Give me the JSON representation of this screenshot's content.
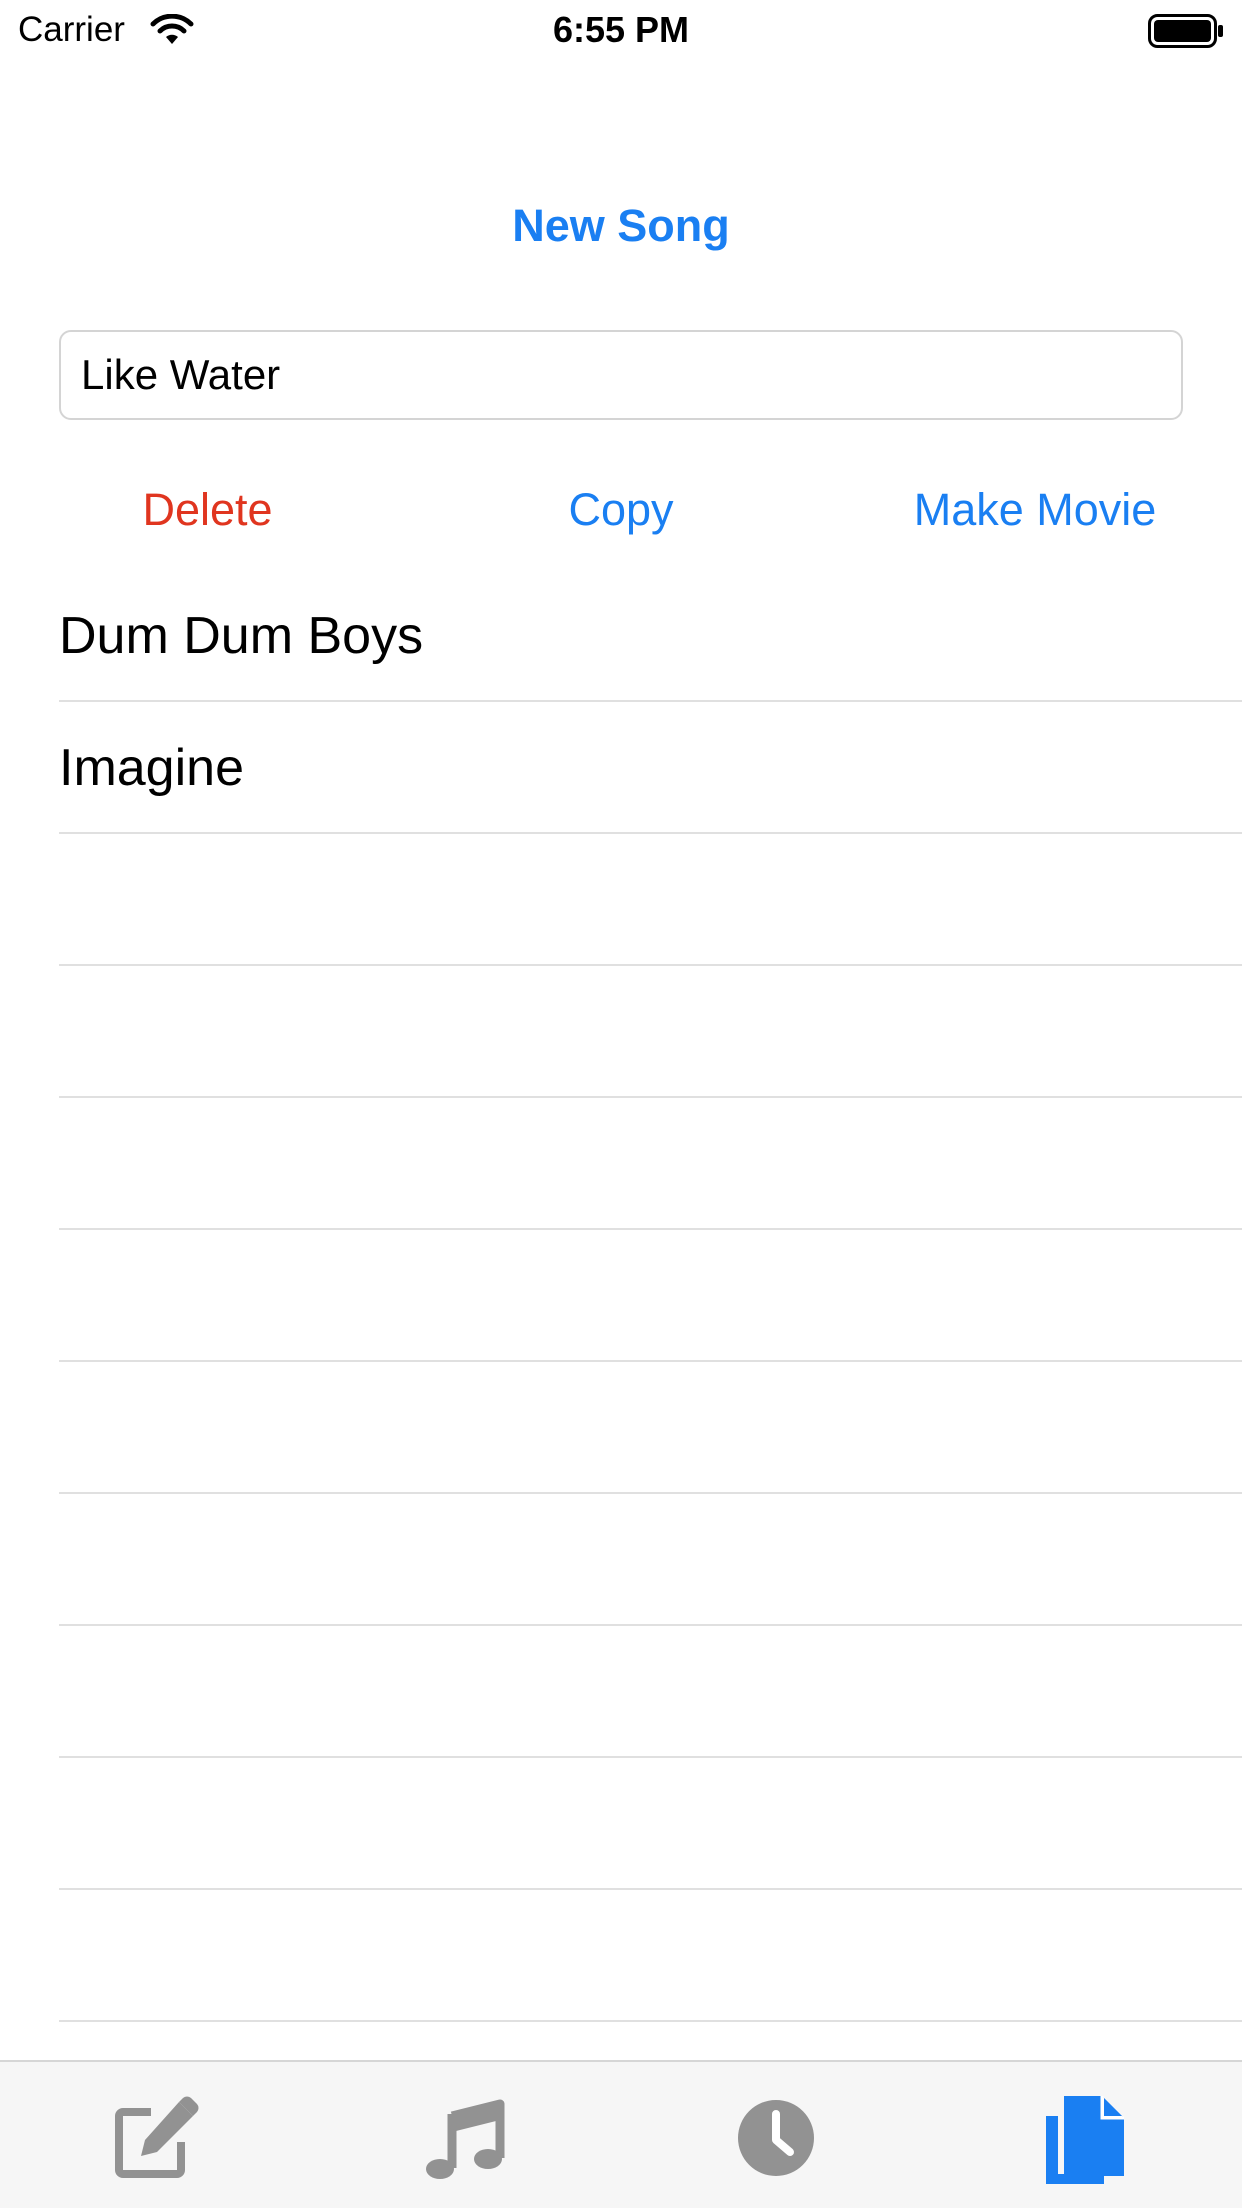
{
  "status_bar": {
    "carrier": "Carrier",
    "time": "6:55 PM",
    "wifi_icon": "wifi-icon",
    "battery_icon": "battery-icon"
  },
  "header": {
    "title": "New Song"
  },
  "song_name_field": {
    "value": "Like Water"
  },
  "actions": {
    "delete_label": "Delete",
    "copy_label": "Copy",
    "make_movie_label": "Make Movie"
  },
  "songs": [
    {
      "title": "Dum Dum Boys"
    },
    {
      "title": "Imagine"
    },
    {
      "title": ""
    },
    {
      "title": ""
    },
    {
      "title": ""
    },
    {
      "title": ""
    },
    {
      "title": ""
    },
    {
      "title": ""
    },
    {
      "title": ""
    },
    {
      "title": ""
    },
    {
      "title": ""
    },
    {
      "title": ""
    },
    {
      "title": ""
    },
    {
      "title": ""
    },
    {
      "title": ""
    }
  ],
  "tab_bar": {
    "tabs": [
      {
        "icon": "edit-icon",
        "selected": false
      },
      {
        "icon": "music-note-icon",
        "selected": false
      },
      {
        "icon": "clock-icon",
        "selected": false
      },
      {
        "icon": "documents-icon",
        "selected": true
      }
    ]
  },
  "colors": {
    "accent": "#1a7ff2",
    "destructive": "#e0351f",
    "tab_inactive": "#929292",
    "separator": "#e0e0e0"
  }
}
